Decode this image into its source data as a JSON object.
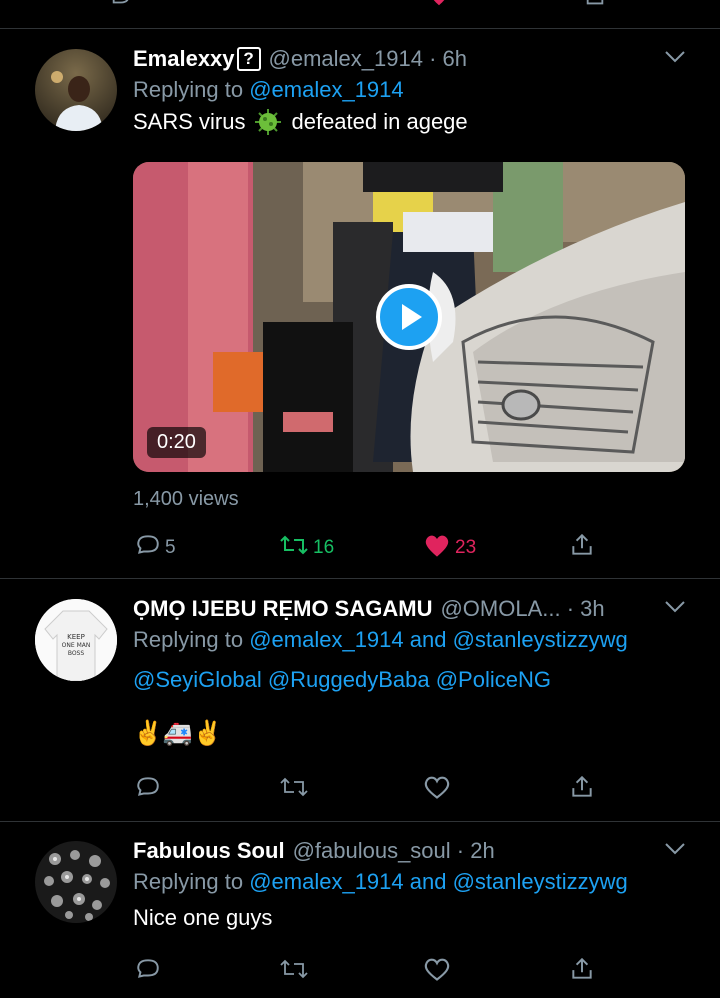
{
  "tweets": [
    {
      "name": "Emalexxy",
      "name_suffix": "?",
      "handle_time": "@emalex_1914 · 6h",
      "replying_prefix": "Replying to",
      "replying_to": "@emalex_1914",
      "text_before": "SARS virus",
      "text_after": "defeated in agege",
      "video_duration": "0:20",
      "views": "1,400 views",
      "reply_count": "5",
      "retweet_count": "16",
      "like_count": "23"
    },
    {
      "name": "ỌMỌ IJEBU RẸMO SAGAMU",
      "handle_time": "@OMOLA... · 3h",
      "replying_prefix": "Replying to",
      "replying_to": "@emalex_1914 and @stanleystizzywg",
      "mentions": "@SeyiGlobal @RuggedyBaba @PoliceNG",
      "emoji_text": "✌️🚑✌️"
    },
    {
      "name": "Fabulous Soul",
      "handle_time": "@fabulous_soul · 2h",
      "replying_prefix": "Replying to",
      "replying_to": "@emalex_1914 and @stanleystizzywg",
      "text": "Nice one guys"
    }
  ],
  "colors": {
    "background": "#000000",
    "secondary_text": "#8899a6",
    "link": "#1da1f2",
    "retweet_active": "#17bf63",
    "like_active": "#e0245e",
    "divider": "#2f3336"
  }
}
